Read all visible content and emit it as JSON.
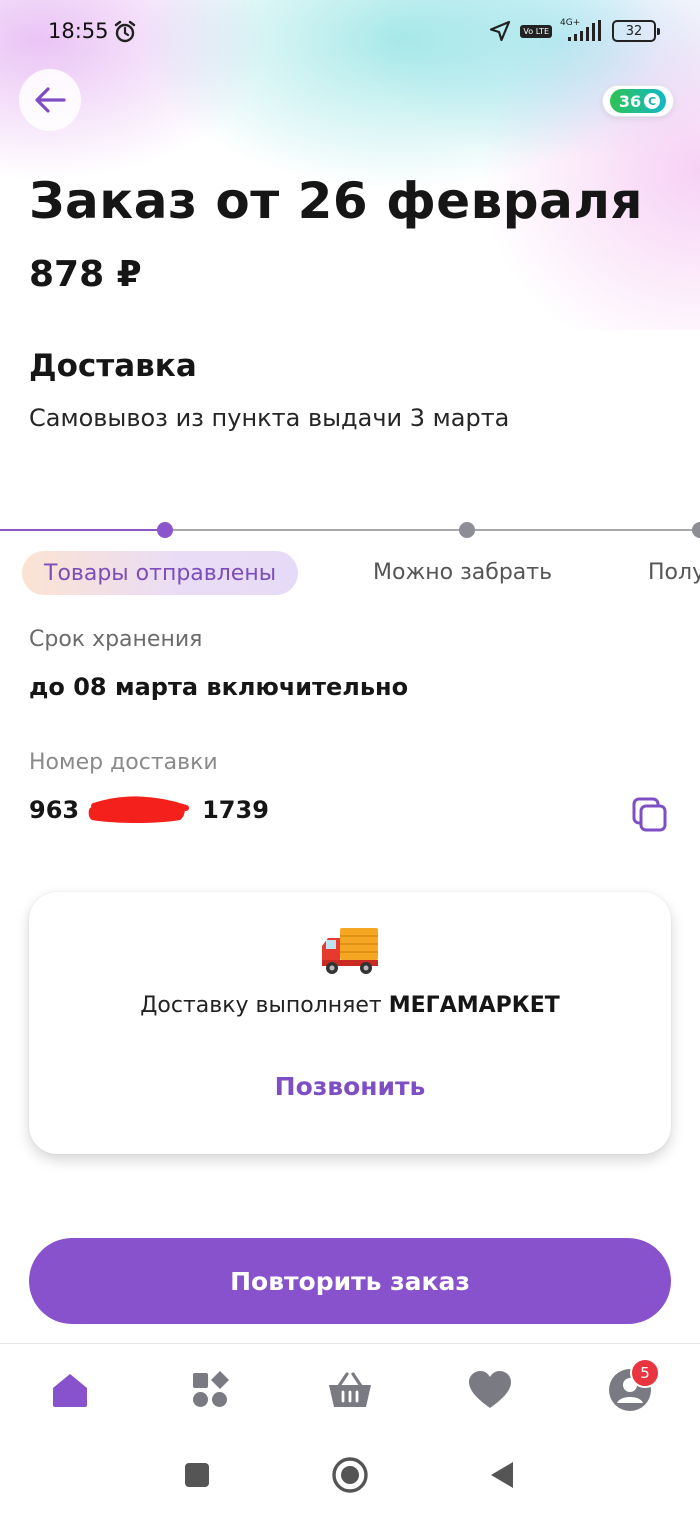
{
  "status_bar": {
    "time": "18:55",
    "network": "4G+",
    "volte": "Vo LTE",
    "battery": "32"
  },
  "header": {
    "bonus_amount": "36",
    "bonus_coin_symbol": "С"
  },
  "order": {
    "title": "Заказ от 26 февраля",
    "total": "878 ₽"
  },
  "delivery": {
    "heading": "Доставка",
    "description": "Самовывоз из пункта выдачи 3 марта"
  },
  "timeline": {
    "steps": [
      {
        "label": "Товары отправлены",
        "state": "current"
      },
      {
        "label": "Можно забрать",
        "state": "pending"
      },
      {
        "label": "Полу",
        "state": "pending"
      }
    ]
  },
  "storage": {
    "label": "Срок хранения",
    "value": "до 08 марта включительно"
  },
  "tracking": {
    "label": "Номер доставки",
    "value_prefix": "963",
    "value_suffix": "1739"
  },
  "carrier": {
    "text_prefix": "Доставку выполняет",
    "name": "МЕГАМАРКЕТ",
    "call_label": "Позвонить"
  },
  "actions": {
    "repeat_order": "Повторить заказ"
  },
  "bottom_nav": {
    "items": [
      {
        "name": "home",
        "icon": "home-icon",
        "active": true
      },
      {
        "name": "catalog",
        "icon": "catalog-icon",
        "active": false
      },
      {
        "name": "cart",
        "icon": "basket-icon",
        "active": false
      },
      {
        "name": "favorites",
        "icon": "heart-icon",
        "active": false
      },
      {
        "name": "profile",
        "icon": "profile-icon",
        "active": false
      }
    ],
    "profile_badge": "5"
  },
  "colors": {
    "accent": "#8752cc",
    "accent_text": "#7e4fc4",
    "nav_inactive": "#7a7a82",
    "badge": "#e8353f"
  }
}
